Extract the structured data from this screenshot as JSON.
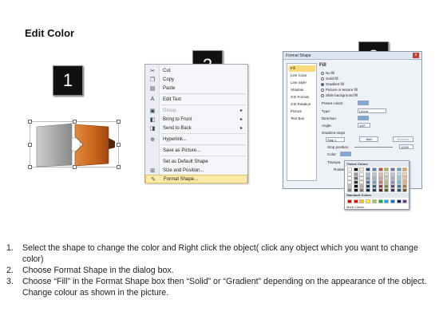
{
  "title": "Edit Color",
  "steps": [
    "1",
    "2",
    "3"
  ],
  "colors": {
    "gray_piece": "#a3a3a3",
    "orange_piece": "#c9651c",
    "badge_bg": "#111111",
    "menu_highlight": "#fde9a8"
  },
  "context_menu": {
    "items": [
      {
        "label": "Cut",
        "icon": "scissors-icon"
      },
      {
        "label": "Copy",
        "icon": "copy-icon"
      },
      {
        "label": "Paste",
        "icon": "paste-icon"
      },
      {
        "label": "Edit Text",
        "icon": "edit-text-icon"
      },
      {
        "label": "Group",
        "icon": "group-icon"
      },
      {
        "label": "Bring to Front",
        "icon": "bring-front-icon"
      },
      {
        "label": "Send to Back",
        "icon": "send-back-icon"
      },
      {
        "label": "Hyperlink...",
        "icon": "hyperlink-icon"
      },
      {
        "label": "Save as Picture...",
        "icon": ""
      },
      {
        "label": "Set as Default Shape",
        "icon": ""
      },
      {
        "label": "Size and Position...",
        "icon": "size-icon"
      },
      {
        "label": "Format Shape...",
        "icon": "format-icon"
      }
    ]
  },
  "dialog": {
    "title": "Format Shape",
    "close": "x",
    "nav": [
      "Fill",
      "Line Color",
      "Line Style",
      "Shadow",
      "3-D Format",
      "3-D Rotation",
      "Picture",
      "Text Box"
    ],
    "fill_heading": "Fill",
    "fill_options": [
      "No fill",
      "Solid fill",
      "Gradient fill",
      "Picture or texture fill",
      "Slide background fill"
    ],
    "preset_colors_label": "Preset colors:",
    "type_label": "Type:",
    "type_value": "Linear",
    "direction_label": "Direction:",
    "angle_label": "Angle:",
    "angle_value": "100°",
    "gradient_stops_label": "Gradient stops",
    "stop_value": "Stop 1",
    "add_label": "Add",
    "remove_label": "Remove",
    "stop_position_label": "Stop position:",
    "stop_position_value": "100%",
    "color_label": "Color:",
    "transparency_label": "Transpa",
    "rotate_label": "Rotate"
  },
  "palette": {
    "theme_header": "Theme Colors",
    "standard_header": "Standard Colors",
    "more": "More Colors...",
    "theme_top": [
      "#ffffff",
      "#000000",
      "#eeece1",
      "#1f497d",
      "#4f81bd",
      "#c0504d",
      "#9bbb59",
      "#8064a2",
      "#4bacc6",
      "#f79646"
    ],
    "standard": [
      "#c00000",
      "#ff0000",
      "#ffc000",
      "#ffff00",
      "#92d050",
      "#00b050",
      "#00b0f0",
      "#0070c0",
      "#002060",
      "#7030a0"
    ]
  },
  "instructions": [
    {
      "num": "1.",
      "text": "Select the shape to change the color and Right click the object( click any object which you want to change color)"
    },
    {
      "num": "2.",
      "text": "Choose Format Shape in the dialog box."
    },
    {
      "num": "3.",
      "text": "Choose “Fill” in the Format Shape box then “Solid” or “Gradient” depending on the appearance of the object. Change colour as shown in the picture."
    }
  ]
}
